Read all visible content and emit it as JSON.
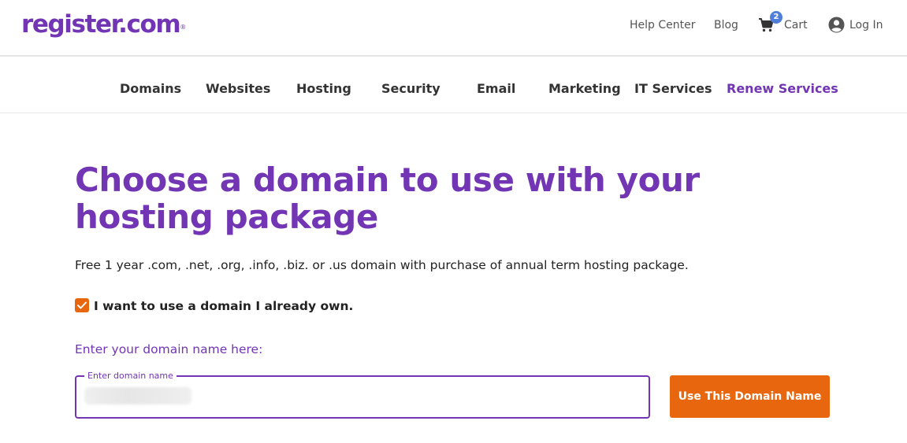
{
  "brand": {
    "logo_text": "register.com",
    "registered_mark": "®",
    "color": "#7235b3"
  },
  "header": {
    "links": {
      "help_center": "Help Center",
      "blog": "Blog",
      "cart": "Cart",
      "cart_count": "2",
      "login": "Log In"
    },
    "icons": {
      "cart": "cart-icon",
      "user": "user-account-icon"
    }
  },
  "nav": {
    "items": [
      {
        "label": "Domains"
      },
      {
        "label": "Websites"
      },
      {
        "label": "Hosting"
      },
      {
        "label": "Security"
      },
      {
        "label": "Email"
      },
      {
        "label": "Marketing"
      },
      {
        "label": "IT Services"
      },
      {
        "label": "Renew Services",
        "active_color": "#7235b3"
      }
    ]
  },
  "main": {
    "title": "Choose a domain to use with your hosting package",
    "subtitle": "Free 1 year .com, .net, .org, .info, .biz. or .us domain with purchase of annual term hosting package.",
    "own_domain_checkbox": {
      "label": "I want to use a domain I already own.",
      "checked": true,
      "color": "#e8660d"
    },
    "field_heading": "Enter your domain name here:",
    "domain_field": {
      "legend": "Enter domain name",
      "value": ""
    },
    "submit_button": {
      "label": "Use This Domain Name",
      "color": "#e8660d"
    }
  }
}
